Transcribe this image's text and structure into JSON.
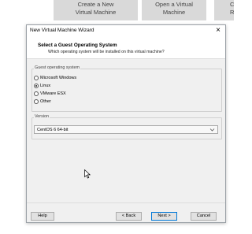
{
  "background": {
    "tiles": [
      {
        "line1": "Create a New",
        "line2": "Virtual Machine"
      },
      {
        "line1": "Open a Virtual",
        "line2": "Machine"
      },
      {
        "line1": "C",
        "line2": "R"
      }
    ]
  },
  "dialog": {
    "title": "New Virtual Machine Wizard",
    "close_glyph": "×",
    "header_title": "Select a Guest Operating System",
    "header_subtitle": "Which operating system will be installed on this virtual machine?",
    "os_group_label": "Guest operating system",
    "os_options": [
      {
        "label": "Microsoft Windows",
        "selected": false
      },
      {
        "label": "Linux",
        "selected": true
      },
      {
        "label": "VMware ESX",
        "selected": false
      },
      {
        "label": "Other",
        "selected": false
      }
    ],
    "version_group_label": "Version",
    "version_value": "CentOS 6 64-bit",
    "buttons": {
      "help": "Help",
      "back": "< Back",
      "next": "Next >",
      "cancel": "Cancel"
    }
  },
  "colors": {
    "accent": "#0078d7",
    "dialog_bg": "#f0f0f0"
  }
}
